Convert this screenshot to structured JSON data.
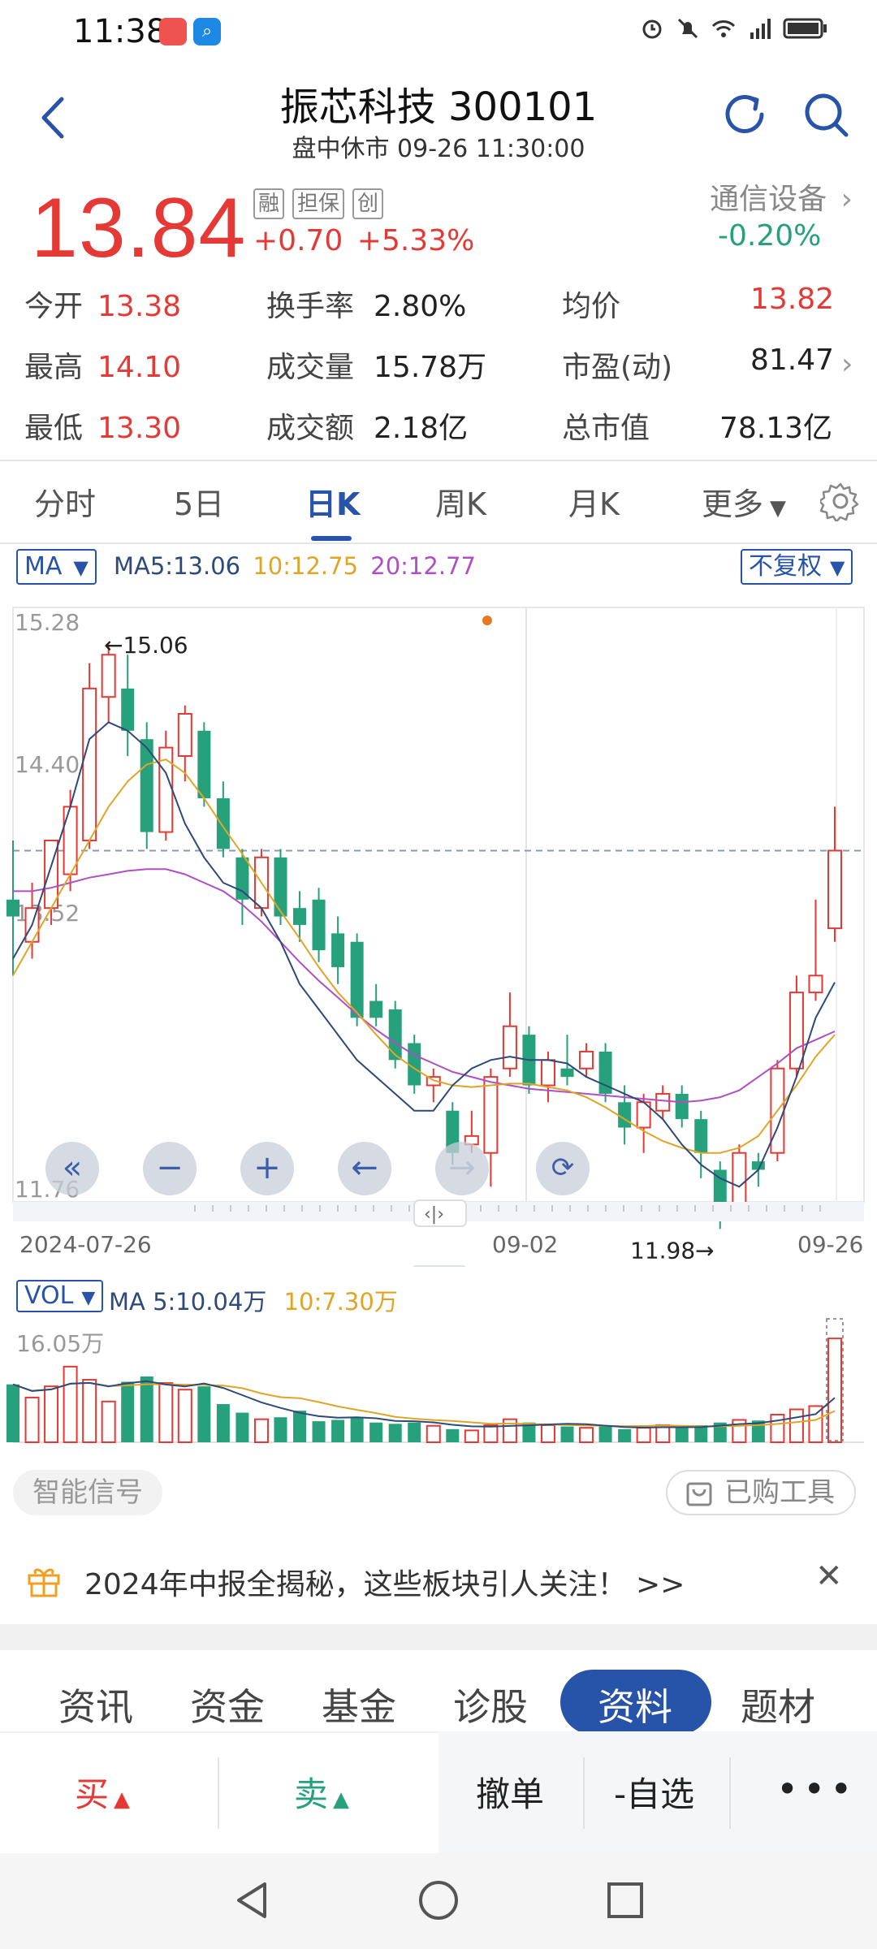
{
  "status": {
    "time": "11:38"
  },
  "header": {
    "title": "振芯科技 300101",
    "subtitle": "盘中休市 09-26 11:30:00"
  },
  "quote": {
    "price": "13.84",
    "badges": [
      "融",
      "担保",
      "创"
    ],
    "change": "+0.70",
    "change_pct": "+5.33%",
    "sector": "通信设备",
    "sector_pct": "-0.20%"
  },
  "stats": [
    {
      "k": "今开",
      "v": "13.38",
      "color": "red"
    },
    {
      "k": "换手率",
      "v": "2.80%",
      "color": "dark"
    },
    {
      "k": "均价",
      "v": "13.82",
      "color": "red"
    },
    {
      "k": "最高",
      "v": "14.10",
      "color": "red"
    },
    {
      "k": "成交量",
      "v": "15.78万",
      "color": "dark"
    },
    {
      "k": "市盈(动)",
      "v": "81.47",
      "color": "dark"
    },
    {
      "k": "最低",
      "v": "13.30",
      "color": "red"
    },
    {
      "k": "成交额",
      "v": "2.18亿",
      "color": "dark"
    },
    {
      "k": "总市值",
      "v": "78.13亿",
      "color": "dark"
    }
  ],
  "ktabs": [
    "分时",
    "5日",
    "日K",
    "周K",
    "月K",
    "更多"
  ],
  "ktab_active": "日K",
  "ma": {
    "chip": "MA",
    "ma5": "MA5:13.06",
    "ma10": "10:12.75",
    "ma20": "20:12.77",
    "adjust": "不复权",
    "colors": {
      "ma5": "#2e4a7a",
      "ma10": "#e0a526",
      "ma20": "#b04fc4"
    }
  },
  "chart_data": {
    "type": "candlestick",
    "y_ticks": [
      "15.28",
      "14.40",
      "13.52",
      "11.76"
    ],
    "ylim": [
      11.76,
      15.28
    ],
    "x_labels": [
      "2024-07-26",
      "09-02",
      "09-26"
    ],
    "annotations": {
      "high": "←15.06",
      "low": "11.98→"
    },
    "colors": {
      "up": "#e53935",
      "down": "#26a17b"
    },
    "candles": [
      [
        13.55,
        13.9,
        13.1,
        13.45
      ],
      [
        13.3,
        13.65,
        13.2,
        13.5
      ],
      [
        13.5,
        13.85,
        13.4,
        13.9
      ],
      [
        13.7,
        14.2,
        13.6,
        14.1
      ],
      [
        13.9,
        14.95,
        13.85,
        14.8
      ],
      [
        14.75,
        15.06,
        14.6,
        15.0
      ],
      [
        14.8,
        15.0,
        14.4,
        14.55
      ],
      [
        14.5,
        14.6,
        13.85,
        13.95
      ],
      [
        13.95,
        14.55,
        13.9,
        14.45
      ],
      [
        14.4,
        14.7,
        14.25,
        14.65
      ],
      [
        14.55,
        14.6,
        14.1,
        14.15
      ],
      [
        14.15,
        14.25,
        13.8,
        13.85
      ],
      [
        13.8,
        13.85,
        13.4,
        13.55
      ],
      [
        13.5,
        13.85,
        13.45,
        13.8
      ],
      [
        13.8,
        13.85,
        13.4,
        13.45
      ],
      [
        13.5,
        13.6,
        13.3,
        13.4
      ],
      [
        13.55,
        13.62,
        13.18,
        13.25
      ],
      [
        13.35,
        13.45,
        13.05,
        13.15
      ],
      [
        13.3,
        13.35,
        12.8,
        12.85
      ],
      [
        12.95,
        13.05,
        12.8,
        12.85
      ],
      [
        12.9,
        12.95,
        12.55,
        12.6
      ],
      [
        12.7,
        12.75,
        12.4,
        12.45
      ],
      [
        12.45,
        12.55,
        12.35,
        12.5
      ],
      [
        12.3,
        12.35,
        11.98,
        12.05
      ],
      [
        12.1,
        12.3,
        12.05,
        12.15
      ],
      [
        12.05,
        12.55,
        11.85,
        12.5
      ],
      [
        12.55,
        13.0,
        12.5,
        12.8
      ],
      [
        12.75,
        12.8,
        12.4,
        12.45
      ],
      [
        12.45,
        12.65,
        12.35,
        12.6
      ],
      [
        12.55,
        12.75,
        12.45,
        12.5
      ],
      [
        12.55,
        12.7,
        12.5,
        12.65
      ],
      [
        12.65,
        12.7,
        12.35,
        12.4
      ],
      [
        12.35,
        12.45,
        12.1,
        12.2
      ],
      [
        12.2,
        12.4,
        12.05,
        12.35
      ],
      [
        12.3,
        12.45,
        12.25,
        12.4
      ],
      [
        12.4,
        12.45,
        12.2,
        12.25
      ],
      [
        12.25,
        12.3,
        11.9,
        12.05
      ],
      [
        11.95,
        12.0,
        11.6,
        11.75
      ],
      [
        11.75,
        12.1,
        11.7,
        12.05
      ],
      [
        12.0,
        12.05,
        11.85,
        11.95
      ],
      [
        12.05,
        12.6,
        12.0,
        12.55
      ],
      [
        12.55,
        13.1,
        12.5,
        13.0
      ],
      [
        13.0,
        13.55,
        12.95,
        13.1
      ],
      [
        13.38,
        14.1,
        13.3,
        13.84
      ]
    ],
    "ma5": [
      13.2,
      13.4,
      13.75,
      14.1,
      14.5,
      14.6,
      14.55,
      14.45,
      14.3,
      14.0,
      13.8,
      13.65,
      13.6,
      13.5,
      13.3,
      13.05,
      12.9,
      12.75,
      12.6,
      12.5,
      12.4,
      12.3,
      12.3,
      12.45,
      12.55,
      12.6,
      12.62,
      12.6,
      12.6,
      12.58,
      12.5,
      12.45,
      12.4,
      12.35,
      12.25,
      12.1,
      11.98,
      11.9,
      11.85,
      11.95,
      12.2,
      12.5,
      12.85,
      13.06
    ],
    "ma10": [
      13.1,
      13.3,
      13.5,
      13.7,
      13.9,
      14.1,
      14.25,
      14.35,
      14.38,
      14.3,
      14.15,
      13.98,
      13.82,
      13.65,
      13.48,
      13.32,
      13.15,
      13.0,
      12.88,
      12.75,
      12.63,
      12.55,
      12.48,
      12.45,
      12.44,
      12.45,
      12.46,
      12.46,
      12.44,
      12.42,
      12.38,
      12.32,
      12.25,
      12.18,
      12.12,
      12.08,
      12.05,
      12.05,
      12.08,
      12.15,
      12.3,
      12.45,
      12.62,
      12.75
    ],
    "ma20": [
      13.6,
      13.6,
      13.62,
      13.65,
      13.68,
      13.7,
      13.72,
      13.73,
      13.73,
      13.7,
      13.65,
      13.6,
      13.52,
      13.42,
      13.3,
      13.18,
      13.07,
      12.97,
      12.87,
      12.78,
      12.7,
      12.63,
      12.58,
      12.53,
      12.5,
      12.47,
      12.45,
      12.43,
      12.42,
      12.41,
      12.4,
      12.39,
      12.38,
      12.37,
      12.36,
      12.35,
      12.36,
      12.38,
      12.42,
      12.5,
      12.58,
      12.67,
      12.72,
      12.77
    ]
  },
  "volume": {
    "chip": "VOL",
    "ma5": "MA 5:10.04万",
    "ma10": "10:7.30万",
    "top_label": "16.05万",
    "max": 16.05,
    "values": [
      8.8,
      6.8,
      8.5,
      11.5,
      9.5,
      6.2,
      9.2,
      10.0,
      9.0,
      8.0,
      8.5,
      5.8,
      4.5,
      3.5,
      3.8,
      4.8,
      3.2,
      3.4,
      3.8,
      3.0,
      2.8,
      3.0,
      2.5,
      2.0,
      1.8,
      2.6,
      3.5,
      3.0,
      2.6,
      2.4,
      2.2,
      2.4,
      2.0,
      2.2,
      2.6,
      2.2,
      2.6,
      3.0,
      3.4,
      3.3,
      4.2,
      5.0,
      5.5,
      15.78
    ]
  },
  "signal": {
    "label": "智能信号"
  },
  "bought": {
    "label": "已购工具"
  },
  "banner": {
    "text": "2024年中报全揭秘，这些板块引人关注！ >>"
  },
  "bottom_tabs": [
    "资讯",
    "资金",
    "基金",
    "诊股",
    "资料",
    "题材"
  ],
  "bottom_tab_active": "资料",
  "actions": {
    "buy": "买",
    "sell": "卖",
    "cancel": "撤单",
    "watch": "-自选"
  }
}
